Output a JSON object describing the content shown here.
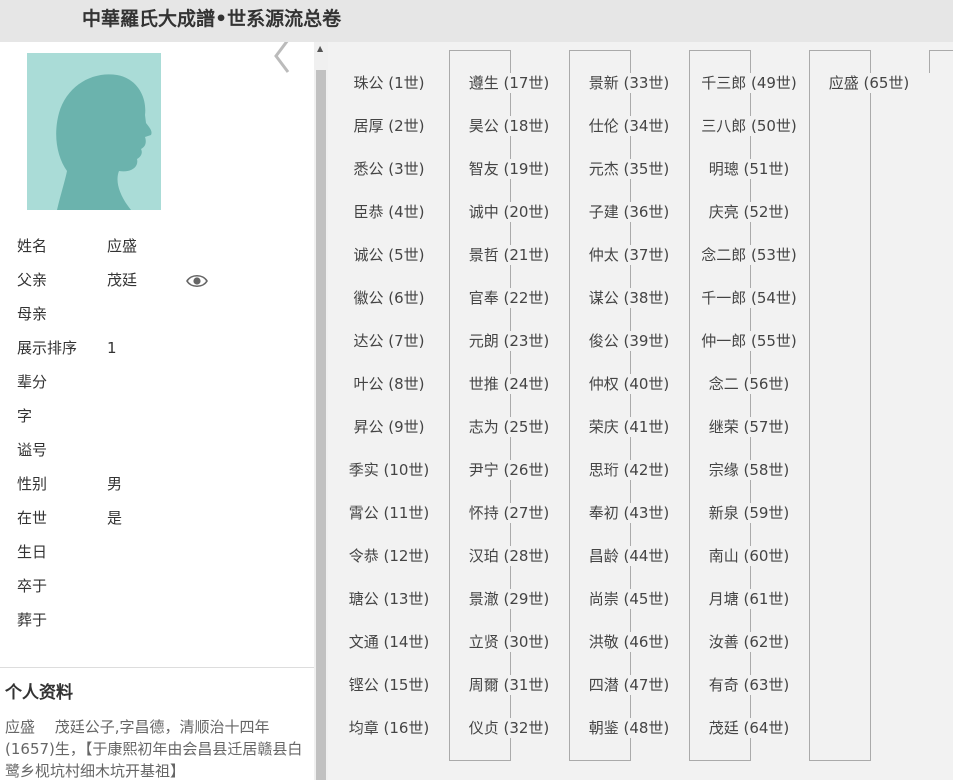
{
  "header": {
    "title": "中華羅氏大成譜•世系源流总卷"
  },
  "profile": {
    "fields": [
      {
        "label": "姓名",
        "value": "应盛"
      },
      {
        "label": "父亲",
        "value": "茂廷"
      },
      {
        "label": "母亲",
        "value": ""
      },
      {
        "label": "展示排序",
        "value": "1"
      },
      {
        "label": "辈分",
        "value": ""
      },
      {
        "label": "字",
        "value": ""
      },
      {
        "label": "谥号",
        "value": ""
      },
      {
        "label": "性别",
        "value": "男"
      },
      {
        "label": "在世",
        "value": "是"
      },
      {
        "label": "生日",
        "value": ""
      },
      {
        "label": "卒于",
        "value": ""
      },
      {
        "label": "葬于",
        "value": ""
      }
    ],
    "bio_title": "个人资料",
    "bio_text": "应盛　 茂廷公子,字昌德，清顺治十四年(1657)生，【于康熙初年由会昌县迁居赣县白鹭乡枧坑村细木坑开基祖】"
  },
  "tree": {
    "columns": [
      [
        "珠公 (1世)",
        "居厚 (2世)",
        "悉公 (3世)",
        "臣恭 (4世)",
        "诚公 (5世)",
        "徽公 (6世)",
        "达公 (7世)",
        "叶公 (8世)",
        "昇公 (9世)",
        "季实 (10世)",
        "霄公 (11世)",
        "令恭 (12世)",
        "瑭公 (13世)",
        "文通 (14世)",
        "铿公 (15世)",
        "均章 (16世)"
      ],
      [
        "遵生 (17世)",
        "昊公 (18世)",
        "智友 (19世)",
        "诚中 (20世)",
        "景哲 (21世)",
        "官奉 (22世)",
        "元朗 (23世)",
        "世推 (24世)",
        "志为 (25世)",
        "尹宁 (26世)",
        "怀持 (27世)",
        "汉珀 (28世)",
        "景澈 (29世)",
        "立贤 (30世)",
        "周爾 (31世)",
        "仪贞 (32世)"
      ],
      [
        "景新 (33世)",
        "仕伦 (34世)",
        "元杰 (35世)",
        "子建 (36世)",
        "仲太 (37世)",
        "谋公 (38世)",
        "俊公 (39世)",
        "仲权 (40世)",
        "荣庆 (41世)",
        "思珩 (42世)",
        "奉初 (43世)",
        "昌龄 (44世)",
        "尚崇 (45世)",
        "洪敬 (46世)",
        "四潜 (47世)",
        "朝鉴 (48世)"
      ],
      [
        "千三郎 (49世)",
        "三八郎 (50世)",
        "明璁 (51世)",
        "庆亮 (52世)",
        "念二郎 (53世)",
        "千一郎 (54世)",
        "仲一郎 (55世)",
        "念二 (56世)",
        "继荣 (57世)",
        "宗缘 (58世)",
        "新泉 (59世)",
        "南山 (60世)",
        "月塘 (61世)",
        "汝善 (62世)",
        "有奇 (63世)",
        "茂廷 (64世)"
      ],
      [
        "应盛 (65世)"
      ]
    ]
  },
  "colors": {
    "header_bg": "#e6e6e6",
    "tree_bg": "#f2f2f2",
    "avatar_bg": "#aadcd7",
    "avatar_silhouette": "#6bb3ad"
  },
  "icons": {
    "collapse": "chevron-left-icon",
    "view": "eye-icon",
    "avatar": "person-silhouette-icon"
  }
}
